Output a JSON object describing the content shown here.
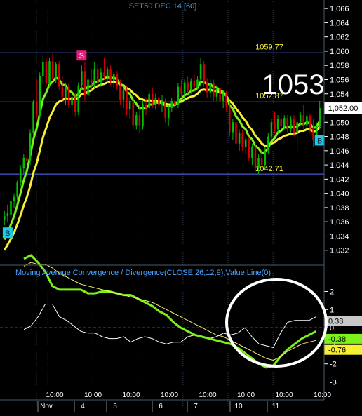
{
  "title": "SET50 DEC 14   [60]",
  "big_price": "1053",
  "colors": {
    "background": "#000000",
    "grid": "#2a3a4a",
    "bull_candle": "#00c000",
    "bear_candle": "#d80000",
    "fast_ma": "#7cf21a",
    "slow_ma": "#f7f030",
    "hline": "#5a6cff",
    "macd_line": "#7cf21a",
    "signal_line": "#f7f070",
    "histogram_line": "#ffffff",
    "axis_text": "#ffffff",
    "title_text": "#4aa3ff",
    "circle": "#ffffff"
  },
  "chart_data": [
    {
      "type": "candlestick",
      "title": "SET50 DEC 14   [60]",
      "ylim": [
        1030,
        1067
      ],
      "y_ticks": [
        "1,066",
        "1,064",
        "1,062",
        "1,060",
        "1,058",
        "1,056",
        "1,054",
        "1,052",
        "1,050",
        "1,048",
        "1,046",
        "1,044",
        "1,042",
        "1,040",
        "1,038",
        "1,036",
        "1,034",
        "1,032"
      ],
      "y_tick_values": [
        1066,
        1064,
        1062,
        1060,
        1058,
        1056,
        1054,
        1052,
        1050,
        1048,
        1046,
        1044,
        1042,
        1040,
        1038,
        1036,
        1034,
        1032
      ],
      "last_price_label": "1,052.00",
      "last_price": 1052,
      "reference_lines": [
        {
          "value": 1059.77,
          "label": "1059.77"
        },
        {
          "value": 1052.87,
          "label": "1052.87"
        },
        {
          "value": 1042.71,
          "label": "1042.71"
        }
      ],
      "signals": [
        {
          "index": 1,
          "label": "B",
          "type": "buy"
        },
        {
          "index": 24,
          "label": "S",
          "type": "sell"
        },
        {
          "index": 98,
          "label": "B",
          "type": "buy"
        }
      ],
      "candles": [
        {
          "o": 1036.2,
          "h": 1037.5,
          "l": 1035.5,
          "c": 1036.8
        },
        {
          "o": 1036.8,
          "h": 1038.4,
          "l": 1036.0,
          "c": 1037.2
        },
        {
          "o": 1037.0,
          "h": 1039.2,
          "l": 1036.6,
          "c": 1038.9
        },
        {
          "o": 1038.9,
          "h": 1040.0,
          "l": 1038.0,
          "c": 1039.5
        },
        {
          "o": 1039.5,
          "h": 1041.8,
          "l": 1039.0,
          "c": 1041.5
        },
        {
          "o": 1041.5,
          "h": 1044.0,
          "l": 1041.0,
          "c": 1043.5
        },
        {
          "o": 1043.5,
          "h": 1045.6,
          "l": 1042.8,
          "c": 1045.0
        },
        {
          "o": 1045.0,
          "h": 1046.2,
          "l": 1044.0,
          "c": 1044.5
        },
        {
          "o": 1044.5,
          "h": 1049.0,
          "l": 1044.0,
          "c": 1048.5
        },
        {
          "o": 1048.5,
          "h": 1053.2,
          "l": 1048.0,
          "c": 1052.8
        },
        {
          "o": 1052.8,
          "h": 1056.0,
          "l": 1050.5,
          "c": 1051.0
        },
        {
          "o": 1051.0,
          "h": 1057.0,
          "l": 1050.5,
          "c": 1056.5
        },
        {
          "o": 1056.5,
          "h": 1059.5,
          "l": 1055.5,
          "c": 1058.5
        },
        {
          "o": 1058.5,
          "h": 1059.0,
          "l": 1055.0,
          "c": 1055.5
        },
        {
          "o": 1055.5,
          "h": 1059.0,
          "l": 1055.0,
          "c": 1058.6
        },
        {
          "o": 1058.6,
          "h": 1059.8,
          "l": 1055.8,
          "c": 1056.2
        },
        {
          "o": 1056.2,
          "h": 1058.5,
          "l": 1055.5,
          "c": 1058.2
        },
        {
          "o": 1058.2,
          "h": 1058.6,
          "l": 1054.5,
          "c": 1055.0
        },
        {
          "o": 1055.0,
          "h": 1056.5,
          "l": 1053.0,
          "c": 1053.6
        },
        {
          "o": 1053.6,
          "h": 1055.5,
          "l": 1052.5,
          "c": 1055.0
        },
        {
          "o": 1055.0,
          "h": 1055.5,
          "l": 1052.0,
          "c": 1052.5
        },
        {
          "o": 1052.5,
          "h": 1054.0,
          "l": 1051.0,
          "c": 1053.5
        },
        {
          "o": 1053.5,
          "h": 1054.2,
          "l": 1050.8,
          "c": 1051.5
        },
        {
          "o": 1051.5,
          "h": 1055.6,
          "l": 1051.0,
          "c": 1055.2
        },
        {
          "o": 1055.2,
          "h": 1058.0,
          "l": 1054.5,
          "c": 1057.2
        },
        {
          "o": 1057.2,
          "h": 1058.5,
          "l": 1053.0,
          "c": 1053.8
        },
        {
          "o": 1053.8,
          "h": 1056.5,
          "l": 1052.0,
          "c": 1056.0
        },
        {
          "o": 1056.0,
          "h": 1057.5,
          "l": 1054.5,
          "c": 1055.2
        },
        {
          "o": 1055.2,
          "h": 1058.5,
          "l": 1054.8,
          "c": 1057.5
        },
        {
          "o": 1057.5,
          "h": 1058.2,
          "l": 1055.0,
          "c": 1055.6
        },
        {
          "o": 1055.6,
          "h": 1057.6,
          "l": 1055.0,
          "c": 1057.0
        },
        {
          "o": 1057.0,
          "h": 1059.0,
          "l": 1056.0,
          "c": 1056.4
        },
        {
          "o": 1056.4,
          "h": 1057.8,
          "l": 1055.5,
          "c": 1057.4
        },
        {
          "o": 1057.4,
          "h": 1058.0,
          "l": 1055.2,
          "c": 1055.8
        },
        {
          "o": 1055.8,
          "h": 1057.0,
          "l": 1054.8,
          "c": 1056.8
        },
        {
          "o": 1056.8,
          "h": 1057.2,
          "l": 1054.5,
          "c": 1055.0
        },
        {
          "o": 1055.0,
          "h": 1056.0,
          "l": 1052.5,
          "c": 1053.2
        },
        {
          "o": 1053.2,
          "h": 1055.0,
          "l": 1052.0,
          "c": 1054.6
        },
        {
          "o": 1054.6,
          "h": 1055.2,
          "l": 1051.0,
          "c": 1051.8
        },
        {
          "o": 1051.8,
          "h": 1053.5,
          "l": 1050.5,
          "c": 1053.0
        },
        {
          "o": 1053.0,
          "h": 1053.5,
          "l": 1049.0,
          "c": 1049.6
        },
        {
          "o": 1049.6,
          "h": 1051.5,
          "l": 1049.0,
          "c": 1051.0
        },
        {
          "o": 1051.0,
          "h": 1052.5,
          "l": 1048.5,
          "c": 1049.5
        },
        {
          "o": 1049.5,
          "h": 1053.0,
          "l": 1049.0,
          "c": 1052.5
        },
        {
          "o": 1052.5,
          "h": 1053.5,
          "l": 1051.0,
          "c": 1052.0
        },
        {
          "o": 1052.0,
          "h": 1054.5,
          "l": 1051.5,
          "c": 1054.0
        },
        {
          "o": 1054.0,
          "h": 1054.8,
          "l": 1052.0,
          "c": 1052.5
        },
        {
          "o": 1052.5,
          "h": 1054.0,
          "l": 1051.8,
          "c": 1053.5
        },
        {
          "o": 1053.5,
          "h": 1054.0,
          "l": 1052.0,
          "c": 1052.4
        },
        {
          "o": 1052.4,
          "h": 1053.8,
          "l": 1051.5,
          "c": 1053.0
        },
        {
          "o": 1053.0,
          "h": 1053.4,
          "l": 1050.0,
          "c": 1050.6
        },
        {
          "o": 1050.6,
          "h": 1052.5,
          "l": 1049.5,
          "c": 1052.0
        },
        {
          "o": 1052.0,
          "h": 1053.5,
          "l": 1051.5,
          "c": 1053.0
        },
        {
          "o": 1053.0,
          "h": 1054.5,
          "l": 1052.0,
          "c": 1052.4
        },
        {
          "o": 1052.4,
          "h": 1055.5,
          "l": 1052.0,
          "c": 1055.0
        },
        {
          "o": 1055.0,
          "h": 1056.0,
          "l": 1053.5,
          "c": 1054.0
        },
        {
          "o": 1054.0,
          "h": 1056.0,
          "l": 1053.0,
          "c": 1055.6
        },
        {
          "o": 1055.6,
          "h": 1056.4,
          "l": 1054.0,
          "c": 1054.5
        },
        {
          "o": 1054.5,
          "h": 1056.2,
          "l": 1054.0,
          "c": 1055.8
        },
        {
          "o": 1055.8,
          "h": 1056.8,
          "l": 1054.5,
          "c": 1055.0
        },
        {
          "o": 1055.0,
          "h": 1056.5,
          "l": 1054.5,
          "c": 1056.0
        },
        {
          "o": 1056.0,
          "h": 1059.0,
          "l": 1055.0,
          "c": 1058.2
        },
        {
          "o": 1058.2,
          "h": 1058.6,
          "l": 1055.0,
          "c": 1055.6
        },
        {
          "o": 1055.6,
          "h": 1056.2,
          "l": 1053.5,
          "c": 1054.2
        },
        {
          "o": 1054.2,
          "h": 1056.0,
          "l": 1053.5,
          "c": 1055.5
        },
        {
          "o": 1055.5,
          "h": 1056.0,
          "l": 1053.0,
          "c": 1053.6
        },
        {
          "o": 1053.6,
          "h": 1055.2,
          "l": 1053.0,
          "c": 1054.8
        },
        {
          "o": 1054.8,
          "h": 1055.5,
          "l": 1052.5,
          "c": 1053.0
        },
        {
          "o": 1053.0,
          "h": 1054.5,
          "l": 1052.0,
          "c": 1054.0
        },
        {
          "o": 1054.0,
          "h": 1054.4,
          "l": 1051.5,
          "c": 1052.2
        },
        {
          "o": 1052.2,
          "h": 1053.0,
          "l": 1048.0,
          "c": 1048.6
        },
        {
          "o": 1048.6,
          "h": 1050.5,
          "l": 1047.5,
          "c": 1050.0
        },
        {
          "o": 1050.0,
          "h": 1050.5,
          "l": 1046.5,
          "c": 1047.0
        },
        {
          "o": 1047.0,
          "h": 1049.0,
          "l": 1046.0,
          "c": 1048.5
        },
        {
          "o": 1048.5,
          "h": 1049.0,
          "l": 1046.0,
          "c": 1046.5
        },
        {
          "o": 1046.5,
          "h": 1048.0,
          "l": 1045.5,
          "c": 1047.6
        },
        {
          "o": 1047.6,
          "h": 1048.0,
          "l": 1044.5,
          "c": 1045.0
        },
        {
          "o": 1045.0,
          "h": 1047.0,
          "l": 1044.0,
          "c": 1046.5
        },
        {
          "o": 1046.5,
          "h": 1047.0,
          "l": 1043.0,
          "c": 1043.6
        },
        {
          "o": 1043.6,
          "h": 1045.5,
          "l": 1042.7,
          "c": 1045.0
        },
        {
          "o": 1045.0,
          "h": 1046.0,
          "l": 1043.5,
          "c": 1044.0
        },
        {
          "o": 1044.0,
          "h": 1046.5,
          "l": 1043.5,
          "c": 1046.0
        },
        {
          "o": 1046.0,
          "h": 1048.5,
          "l": 1045.5,
          "c": 1048.0
        },
        {
          "o": 1048.0,
          "h": 1050.5,
          "l": 1047.5,
          "c": 1050.0
        },
        {
          "o": 1050.0,
          "h": 1051.5,
          "l": 1048.5,
          "c": 1049.0
        },
        {
          "o": 1049.0,
          "h": 1051.0,
          "l": 1048.5,
          "c": 1050.5
        },
        {
          "o": 1050.5,
          "h": 1051.5,
          "l": 1049.0,
          "c": 1049.5
        },
        {
          "o": 1049.5,
          "h": 1051.0,
          "l": 1049.0,
          "c": 1050.6
        },
        {
          "o": 1050.6,
          "h": 1051.0,
          "l": 1048.5,
          "c": 1049.0
        },
        {
          "o": 1049.0,
          "h": 1050.8,
          "l": 1048.5,
          "c": 1050.4
        },
        {
          "o": 1050.4,
          "h": 1051.0,
          "l": 1048.0,
          "c": 1048.5
        },
        {
          "o": 1048.5,
          "h": 1050.5,
          "l": 1046.0,
          "c": 1050.0
        },
        {
          "o": 1050.0,
          "h": 1051.5,
          "l": 1049.5,
          "c": 1051.0
        },
        {
          "o": 1051.0,
          "h": 1052.5,
          "l": 1049.0,
          "c": 1049.6
        },
        {
          "o": 1049.6,
          "h": 1051.0,
          "l": 1049.0,
          "c": 1050.8
        },
        {
          "o": 1050.8,
          "h": 1051.2,
          "l": 1048.5,
          "c": 1049.2
        },
        {
          "o": 1049.2,
          "h": 1050.5,
          "l": 1046.5,
          "c": 1047.5
        },
        {
          "o": 1047.5,
          "h": 1050.0,
          "l": 1047.0,
          "c": 1049.5
        },
        {
          "o": 1049.5,
          "h": 1053.0,
          "l": 1049.0,
          "c": 1052.0
        }
      ],
      "fast_ma": [
        1033.5,
        1034.5,
        1035.6,
        1036.8,
        1038.3,
        1040.0,
        1041.8,
        1043.2,
        1045.2,
        1047.6,
        1049.1,
        1051.2,
        1053.3,
        1054.2,
        1055.3,
        1055.7,
        1056.3,
        1056.0,
        1055.3,
        1055.2,
        1054.5,
        1054.2,
        1053.6,
        1054.0,
        1054.8,
        1054.6,
        1055.0,
        1055.1,
        1055.7,
        1055.7,
        1056.0,
        1056.1,
        1056.4,
        1056.2,
        1056.3,
        1056.0,
        1055.3,
        1055.1,
        1054.3,
        1054.0,
        1053.1,
        1052.6,
        1051.9,
        1052.0,
        1052.0,
        1052.5,
        1052.5,
        1052.8,
        1052.7,
        1052.8,
        1052.3,
        1052.2,
        1052.4,
        1052.4,
        1053.0,
        1053.3,
        1053.8,
        1054.0,
        1054.4,
        1054.5,
        1054.8,
        1055.7,
        1055.7,
        1055.3,
        1055.4,
        1054.9,
        1054.9,
        1054.4,
        1054.3,
        1053.7,
        1052.4,
        1051.9,
        1050.8,
        1050.3,
        1049.4,
        1049.0,
        1048.0,
        1047.6,
        1046.7,
        1046.3,
        1045.7,
        1045.8,
        1046.4,
        1047.3,
        1047.8,
        1048.6,
        1048.8,
        1049.3,
        1049.2,
        1049.5,
        1049.2,
        1049.4,
        1049.8,
        1049.7,
        1050.0,
        1049.8,
        1049.2,
        1049.3,
        1050.2
      ],
      "slow_ma": [
        1032.0,
        1032.8,
        1033.6,
        1034.5,
        1035.6,
        1036.9,
        1038.3,
        1039.5,
        1041.0,
        1042.9,
        1044.2,
        1046.0,
        1047.9,
        1049.2,
        1050.6,
        1051.5,
        1052.5,
        1052.9,
        1053.1,
        1053.4,
        1053.3,
        1053.4,
        1053.2,
        1053.5,
        1054.0,
        1054.0,
        1054.3,
        1054.5,
        1054.9,
        1055.1,
        1055.3,
        1055.4,
        1055.6,
        1055.6,
        1055.7,
        1055.6,
        1055.3,
        1055.2,
        1054.8,
        1054.6,
        1054.1,
        1053.8,
        1053.3,
        1053.2,
        1053.0,
        1053.1,
        1053.0,
        1053.0,
        1052.9,
        1052.9,
        1052.6,
        1052.5,
        1052.5,
        1052.5,
        1052.8,
        1052.9,
        1053.2,
        1053.4,
        1053.6,
        1053.7,
        1054.0,
        1054.5,
        1054.6,
        1054.5,
        1054.6,
        1054.4,
        1054.4,
        1054.2,
        1054.1,
        1053.7,
        1053.0,
        1052.6,
        1051.9,
        1051.4,
        1050.7,
        1050.2,
        1049.4,
        1048.9,
        1048.1,
        1047.6,
        1047.0,
        1046.7,
        1046.7,
        1047.0,
        1047.2,
        1047.6,
        1047.8,
        1048.1,
        1048.2,
        1048.4,
        1048.4,
        1048.5,
        1048.8,
        1048.8,
        1049.0,
        1049.0,
        1048.7,
        1048.8,
        1049.4
      ]
    },
    {
      "type": "line",
      "title": "Moving Average Convergence / Divergence(CLOSE,26,12,9),Value Line(0)",
      "ylim": [
        -3.6,
        2.6
      ],
      "y_ticks": [
        "2",
        "1",
        "0",
        "-1",
        "-2",
        "-3"
      ],
      "y_tick_values": [
        2,
        1,
        0,
        -1,
        -2,
        -3
      ],
      "value_labels": [
        {
          "label": "0.38",
          "value": 0.38
        },
        {
          "label": "-0.38",
          "value": -0.38
        },
        {
          "label": "-0.76",
          "value": -0.76
        }
      ],
      "series": [
        {
          "values": [
            -0.1,
            0.1,
            0.6,
            1.3,
            1.3,
            0.6,
            0.4,
            0.1,
            -0.2,
            -0.3,
            -0.3,
            -0.5,
            -0.6,
            -0.6,
            -0.5,
            -0.8,
            -0.6,
            -0.5,
            -0.6,
            -0.8,
            -0.9,
            -0.8,
            -0.8,
            -0.5,
            -0.4,
            -0.5,
            -0.6,
            -0.5,
            -0.3,
            -0.4,
            -0.3,
            0.0,
            -0.5,
            -0.9,
            -1.0,
            -1.1,
            -0.3,
            0.3,
            0.4,
            0.4,
            0.4,
            0.6
          ]
        },
        {
          "values": [
            3.8,
            4.0,
            3.6,
            3.1,
            2.3,
            2.1,
            2.1,
            2.1,
            2.1,
            1.9,
            1.9,
            2.0,
            2.0,
            1.9,
            1.8,
            1.8,
            1.6,
            1.4,
            1.2,
            0.9,
            0.7,
            0.3,
            0.0,
            -0.2,
            -0.4,
            -0.5,
            -0.6,
            -0.7,
            -0.8,
            -0.9,
            -1.1,
            -1.4,
            -1.7,
            -2.0,
            -2.2,
            -2.1,
            -1.6,
            -1.2,
            -0.9,
            -0.6,
            -0.4,
            -0.2
          ]
        },
        {
          "values": [
            3.4,
            3.6,
            3.5,
            3.5,
            3.3,
            3.0,
            2.8,
            2.6,
            2.4,
            2.3,
            2.2,
            2.1,
            2.0,
            1.9,
            1.8,
            1.7,
            1.6,
            1.5,
            1.4,
            1.2,
            1.0,
            0.8,
            0.6,
            0.4,
            0.2,
            0.0,
            -0.2,
            -0.4,
            -0.5,
            -0.7,
            -0.9,
            -1.1,
            -1.3,
            -1.5,
            -1.7,
            -1.8,
            -1.6,
            -1.3,
            -1.1,
            -0.9,
            -0.8,
            -0.7
          ]
        }
      ]
    }
  ],
  "x_axis": {
    "time_labels": [
      "10:00",
      "10:00",
      "10:00",
      "10:00",
      "10:00",
      "10:00",
      "10:00",
      "10:00"
    ],
    "date_labels": [
      "Nov",
      "4",
      "5",
      "6",
      "7",
      "10",
      "11"
    ]
  }
}
